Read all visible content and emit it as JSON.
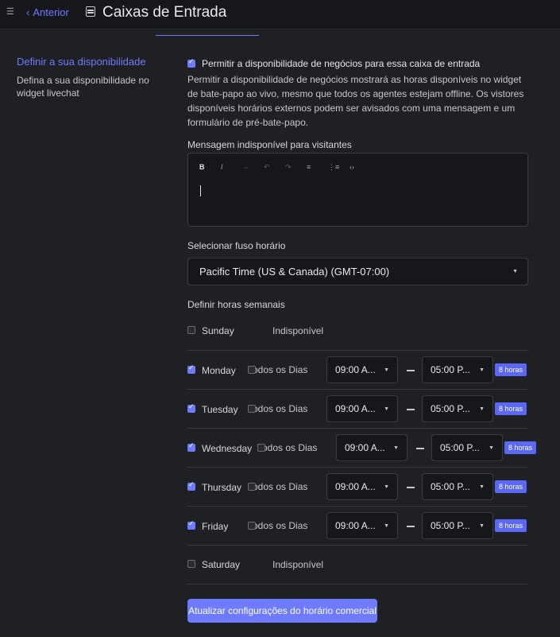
{
  "header": {
    "menu_icon": "hamburger-icon",
    "back_label": "Anterior",
    "title": "Caixas de Entrada",
    "accent": "#6f7bff"
  },
  "sidebar": {
    "title": "Definir a sua disponibilidade",
    "description": "Defina a sua disponibilidade no widget livechat"
  },
  "availability": {
    "enabled": true,
    "toggle_label": "Permitir a disponibilidade de negócios para essa caixa de entrada",
    "description": "Permitir a disponibilidade de negócios mostrará as horas disponíveis no widget de bate-papo ao vivo, mesmo que todos os agentes estejam offline. Os vistores disponíveis horários externos podem ser avisados com uma mensagem e um formulário de pré-bate-papo."
  },
  "message": {
    "label": "Mensagem indisponível para visitantes",
    "value": "",
    "toolbar": [
      "bold-icon",
      "italic-icon",
      "link-icon",
      "undo-icon",
      "redo-icon",
      "bullet-list-icon",
      "ordered-list-icon",
      "code-icon"
    ]
  },
  "timezone": {
    "label": "Selecionar fuso horário",
    "value": "Pacific Time (US & Canada) (GMT-07:00)"
  },
  "weekly": {
    "label": "Definir horas semanais",
    "all_days_label": "Todos os Dias",
    "unavailable_label": "Indisponível",
    "days": [
      {
        "name": "Sunday",
        "enabled": false,
        "start": "",
        "end": "",
        "hours": ""
      },
      {
        "name": "Monday",
        "enabled": true,
        "start": "09:00 A...",
        "end": "05:00 P...",
        "hours": "8 horas"
      },
      {
        "name": "Tuesday",
        "enabled": true,
        "start": "09:00 A...",
        "end": "05:00 P...",
        "hours": "8 horas"
      },
      {
        "name": "Wednesday",
        "enabled": true,
        "start": "09:00 A...",
        "end": "05:00 P...",
        "hours": "8 horas"
      },
      {
        "name": "Thursday",
        "enabled": true,
        "start": "09:00 A...",
        "end": "05:00 P...",
        "hours": "8 horas"
      },
      {
        "name": "Friday",
        "enabled": true,
        "start": "09:00 A...",
        "end": "05:00 P...",
        "hours": "8 horas"
      },
      {
        "name": "Saturday",
        "enabled": false,
        "start": "",
        "end": "",
        "hours": ""
      }
    ]
  },
  "submit_label": "Atualizar configurações do horário comercial"
}
